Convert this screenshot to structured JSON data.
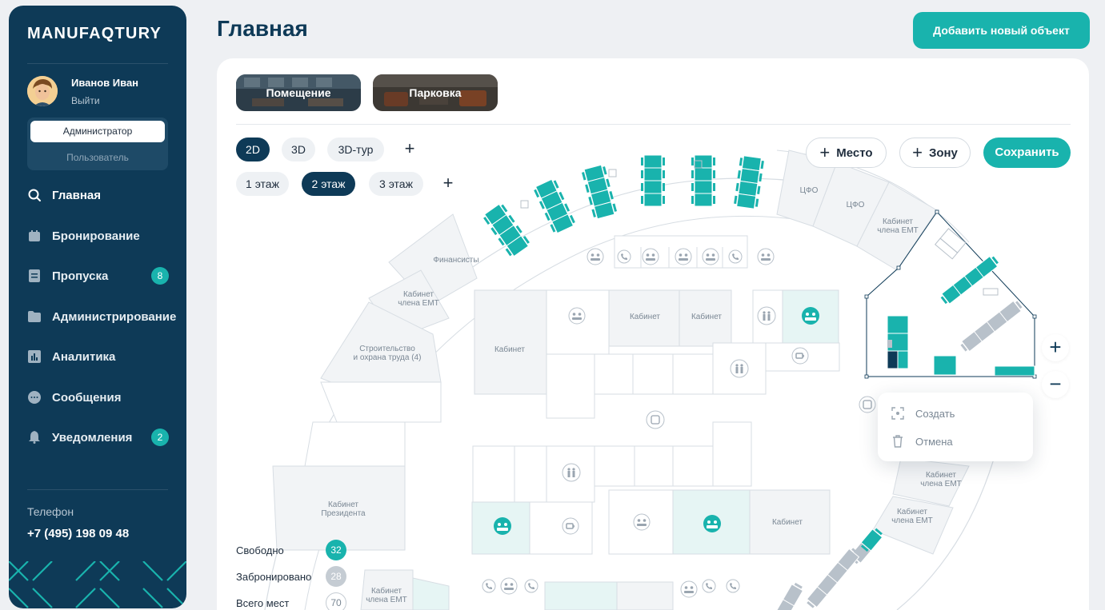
{
  "sidebar": {
    "logo": "MANUFAQTURY",
    "user": {
      "name": "Иванов Иван",
      "logout": "Выйти"
    },
    "roles": {
      "active": "Администратор",
      "other": "Пользователь"
    },
    "nav": [
      {
        "label": "Главная",
        "icon": "search-icon",
        "active": true
      },
      {
        "label": "Бронирование",
        "icon": "calendar-icon"
      },
      {
        "label": "Пропуска",
        "icon": "document-icon",
        "badge": "8"
      },
      {
        "label": "Администрирование",
        "icon": "folder-icon"
      },
      {
        "label": "Аналитика",
        "icon": "chart-icon"
      },
      {
        "label": "Сообщения",
        "icon": "chat-icon"
      },
      {
        "label": "Уведомления",
        "icon": "bell-icon",
        "badge": "2"
      }
    ],
    "phone_label": "Телефон",
    "phone": "+7 (495) 198 09 48"
  },
  "header": {
    "title": "Главная",
    "add_button": "Добавить новый объект"
  },
  "thumbs": {
    "room": "Помещение",
    "parking": "Парковка"
  },
  "view_modes": [
    "2D",
    "3D",
    "3D-тур"
  ],
  "active_view": "2D",
  "floors": [
    "1 этаж",
    "2 этаж",
    "3 этаж"
  ],
  "active_floor": "2 этаж",
  "toolbar": {
    "place": "Место",
    "zone": "Зону",
    "save": "Сохранить"
  },
  "context_menu": {
    "create": "Создать",
    "cancel": "Отмена"
  },
  "map_labels": {
    "finance": "Финансисты",
    "emt": "Кабинет",
    "emt2": "члена ЕМТ",
    "construction1": "Строительство",
    "construction2": "и охрана труда (4)",
    "cabinet": "Кабинет",
    "president1": "Кабинет",
    "president2": "Президента",
    "cfo": "ЦФО"
  },
  "legend": [
    {
      "label": "Свободно",
      "value": "32",
      "color": "#19b3ad"
    },
    {
      "label": "Забронировано",
      "value": "28",
      "color": "#c5ccd3"
    },
    {
      "label": "Всего мест",
      "value": "70",
      "color": "outline"
    }
  ],
  "colors": {
    "brand": "#0e3a57",
    "accent": "#19b3ad",
    "booked": "#b8c1ca",
    "selected": "#0e3a57"
  }
}
